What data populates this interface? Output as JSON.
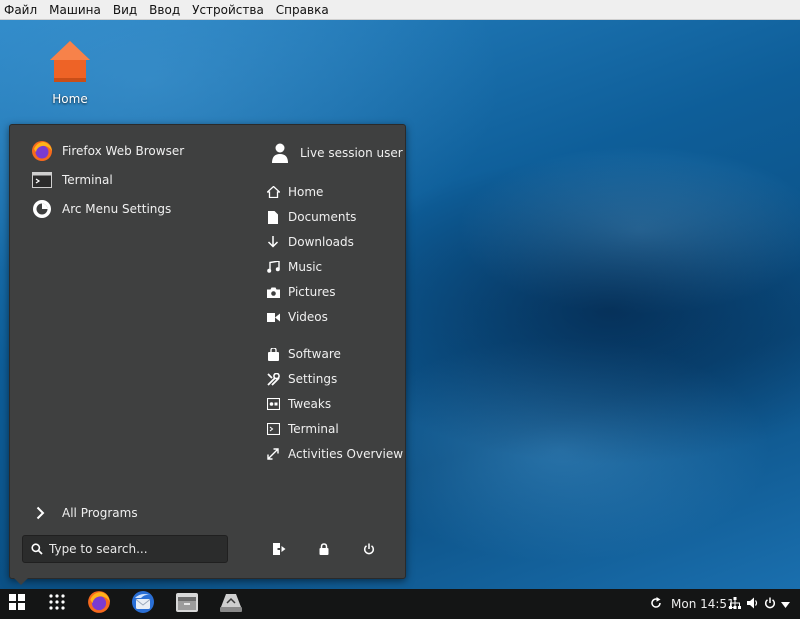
{
  "host_menubar": {
    "items": [
      "Файл",
      "Машина",
      "Вид",
      "Ввод",
      "Устройства",
      "Справка"
    ]
  },
  "desktop": {
    "icons": [
      {
        "label": "Home",
        "icon": "home-folder-icon"
      }
    ]
  },
  "arc_menu": {
    "favorites": [
      {
        "label": "Firefox Web Browser",
        "icon": "firefox-icon"
      },
      {
        "label": "Terminal",
        "icon": "terminal-icon"
      },
      {
        "label": "Arc Menu Settings",
        "icon": "arc-menu-settings-icon"
      }
    ],
    "user": {
      "label": "Live session user",
      "icon": "user-icon"
    },
    "places": [
      {
        "label": "Home",
        "icon": "home-icon"
      },
      {
        "label": "Documents",
        "icon": "document-icon"
      },
      {
        "label": "Downloads",
        "icon": "download-icon"
      },
      {
        "label": "Music",
        "icon": "music-icon"
      },
      {
        "label": "Pictures",
        "icon": "camera-icon"
      },
      {
        "label": "Videos",
        "icon": "video-icon"
      }
    ],
    "system": [
      {
        "label": "Software",
        "icon": "software-bag-icon"
      },
      {
        "label": "Settings",
        "icon": "settings-tools-icon"
      },
      {
        "label": "Tweaks",
        "icon": "tweaks-icon"
      },
      {
        "label": "Terminal",
        "icon": "terminal-small-icon"
      },
      {
        "label": "Activities Overview",
        "icon": "expand-arrows-icon"
      }
    ],
    "all_programs": "All Programs",
    "search": {
      "placeholder": "Type to search..."
    },
    "power_buttons": [
      "logout-icon",
      "lock-icon",
      "power-icon"
    ]
  },
  "taskbar": {
    "clock": "Mon 14:51",
    "apps": [
      "arc-menu-icon",
      "app-grid-icon",
      "firefox-icon",
      "thunderbird-icon",
      "file-manager-icon",
      "installer-icon"
    ],
    "tray": [
      "refresh-icon",
      "network-icon",
      "volume-icon",
      "power-icon",
      "menu-arrow-icon"
    ]
  },
  "colors": {
    "menu_bg": "#3f4040",
    "taskbar_bg": "#141515",
    "text": "#f0f0f0"
  }
}
